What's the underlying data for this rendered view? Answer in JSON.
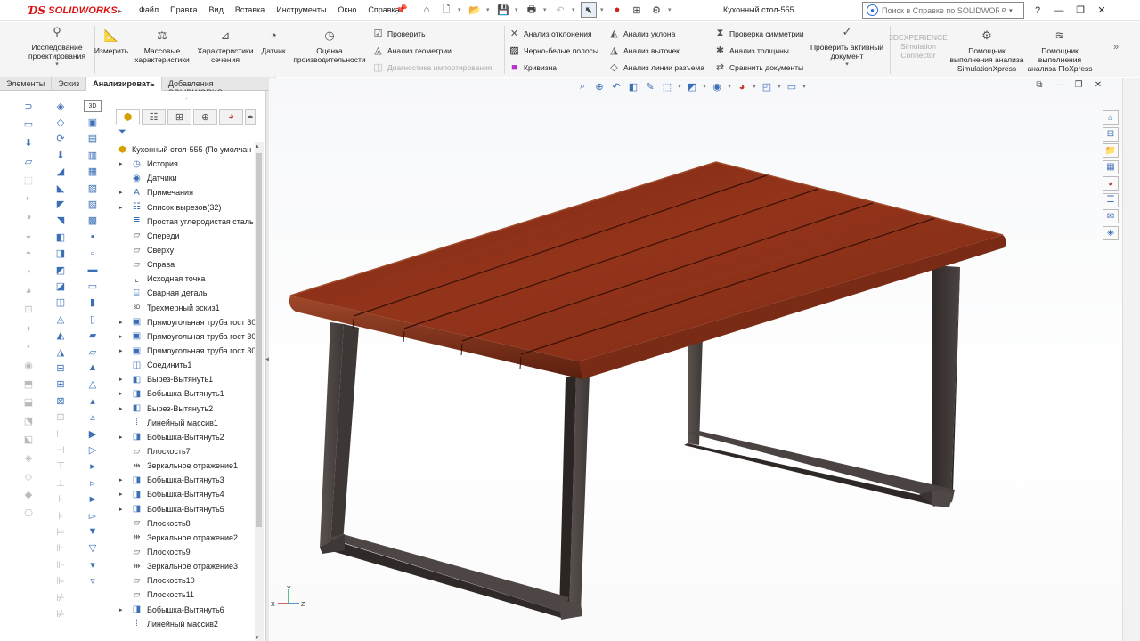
{
  "app": {
    "brand": "SOLIDWORKS",
    "document_title": "Кухонный стол-555"
  },
  "menu": [
    "Файл",
    "Правка",
    "Вид",
    "Вставка",
    "Инструменты",
    "Окно",
    "Справка"
  ],
  "help_search": {
    "placeholder": "Поиск в Справке по SOLIDWORKS"
  },
  "ribbon": {
    "design_study": "Исследование проектирования",
    "measure": "Измерить",
    "mass_props": "Массовые характеристики",
    "section_props": "Характеристики сечения",
    "sensor": "Датчик",
    "performance": "Оценка производительности",
    "check": "Проверить",
    "geometry_analysis": "Анализ геометрии",
    "import_diagnostics": "Диагностика импортирования",
    "deviation": "Анализ отклонения",
    "zebra": "Черно-белые полосы",
    "curvature": "Кривизна",
    "draft": "Анализ уклона",
    "undercut": "Анализ выточек",
    "parting_line": "Анализ линии разъема",
    "symmetry": "Проверка симметрии",
    "thickness": "Анализ толщины",
    "compare": "Сравнить документы",
    "check_active": "Проверить активный документ",
    "sim_connector": "3DEXPERIENCE Simulation Connector",
    "simxpress": "Помощник выполнения анализа SimulationXpress",
    "floxpress": "Помощник выполнения анализа FloXpress"
  },
  "tabs": [
    "Элементы",
    "Эскиз",
    "Анализировать",
    "Добавления SOLIDWORKS"
  ],
  "active_tab": "Анализировать",
  "tree": [
    {
      "label": "Кухонный стол-555  (По умолчан",
      "icon": "part-icon",
      "exp": "",
      "root": true
    },
    {
      "label": "История",
      "icon": "history-icon",
      "exp": "▸"
    },
    {
      "label": "Датчики",
      "icon": "sensor-icon",
      "exp": ""
    },
    {
      "label": "Примечания",
      "icon": "annotations-icon",
      "exp": "▸"
    },
    {
      "label": "Список вырезов(32)",
      "icon": "cutlist-icon",
      "exp": "▸"
    },
    {
      "label": "Простая углеродистая сталь",
      "icon": "material-icon",
      "exp": ""
    },
    {
      "label": "Спереди",
      "icon": "plane-icon",
      "exp": ""
    },
    {
      "label": "Сверху",
      "icon": "plane-icon",
      "exp": ""
    },
    {
      "label": "Справа",
      "icon": "plane-icon",
      "exp": ""
    },
    {
      "label": "Исходная точка",
      "icon": "origin-icon",
      "exp": ""
    },
    {
      "label": "Сварная деталь",
      "icon": "weldment-icon",
      "exp": ""
    },
    {
      "label": "Трехмерный эскиз1",
      "icon": "sketch3d-icon",
      "exp": ""
    },
    {
      "label": "Прямоугольная труба гост 30",
      "icon": "structural-member-icon",
      "exp": "▸"
    },
    {
      "label": "Прямоугольная труба гост 30",
      "icon": "structural-member-icon",
      "exp": "▸"
    },
    {
      "label": "Прямоугольная труба гост 30",
      "icon": "structural-member-icon",
      "exp": "▸"
    },
    {
      "label": "Соединить1",
      "icon": "combine-icon",
      "exp": ""
    },
    {
      "label": "Вырез-Вытянуть1",
      "icon": "extruded-cut-icon",
      "exp": "▸"
    },
    {
      "label": "Бобышка-Вытянуть1",
      "icon": "extruded-boss-icon",
      "exp": "▸"
    },
    {
      "label": "Вырез-Вытянуть2",
      "icon": "extruded-cut-icon",
      "exp": "▸"
    },
    {
      "label": "Линейный массив1",
      "icon": "linear-pattern-icon",
      "exp": ""
    },
    {
      "label": "Бобышка-Вытянуть2",
      "icon": "extruded-boss-icon",
      "exp": "▸"
    },
    {
      "label": "Плоскость7",
      "icon": "plane-icon",
      "exp": ""
    },
    {
      "label": "Зеркальное отражение1",
      "icon": "mirror-icon",
      "exp": ""
    },
    {
      "label": "Бобышка-Вытянуть3",
      "icon": "extruded-boss-icon",
      "exp": "▸"
    },
    {
      "label": "Бобышка-Вытянуть4",
      "icon": "extruded-boss-icon",
      "exp": "▸"
    },
    {
      "label": "Бобышка-Вытянуть5",
      "icon": "extruded-boss-icon",
      "exp": "▸"
    },
    {
      "label": "Плоскость8",
      "icon": "plane-icon",
      "exp": ""
    },
    {
      "label": "Зеркальное отражение2",
      "icon": "mirror-icon",
      "exp": ""
    },
    {
      "label": "Плоскость9",
      "icon": "plane-icon",
      "exp": ""
    },
    {
      "label": "Зеркальное отражение3",
      "icon": "mirror-icon",
      "exp": ""
    },
    {
      "label": "Плоскость10",
      "icon": "plane-icon",
      "exp": ""
    },
    {
      "label": "Плоскость11",
      "icon": "plane-icon",
      "exp": ""
    },
    {
      "label": "Бобышка-Вытянуть6",
      "icon": "extruded-boss-icon",
      "exp": "▸"
    },
    {
      "label": "Линейный массив2",
      "icon": "linear-pattern-icon",
      "exp": ""
    }
  ],
  "triad": {
    "x": "X",
    "y": "Y",
    "z": "Z"
  },
  "colors": {
    "wood": "#8a2e16",
    "steel": "#4a4341",
    "accent": "#2a6fd1",
    "brand": "#d11111"
  }
}
